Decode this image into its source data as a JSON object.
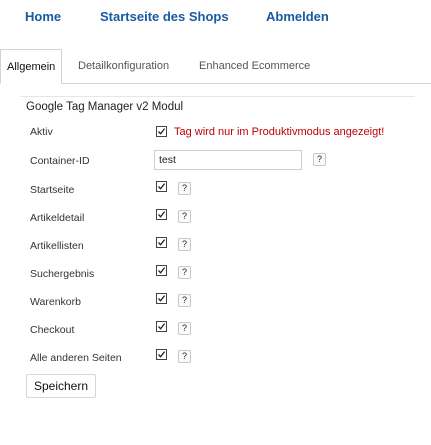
{
  "nav": {
    "home": "Home",
    "shop_home": "Startseite des Shops",
    "logout": "Abmelden"
  },
  "tabs": [
    {
      "label": "Allgemein",
      "active": true
    },
    {
      "label": "Detailkonfiguration",
      "active": false
    },
    {
      "label": "Enhanced Ecommerce",
      "active": false
    }
  ],
  "form": {
    "legend": "Google Tag Manager v2 Modul",
    "aktiv": {
      "label": "Aktiv",
      "checked": true,
      "hint": "Tag wird nur im Produktivmodus angezeigt!"
    },
    "container": {
      "label": "Container-ID",
      "value": "test"
    },
    "pages": [
      {
        "label": "Startseite",
        "checked": true
      },
      {
        "label": "Artikeldetail",
        "checked": true
      },
      {
        "label": "Artikellisten",
        "checked": true
      },
      {
        "label": "Suchergebnis",
        "checked": true
      },
      {
        "label": "Warenkorb",
        "checked": true
      },
      {
        "label": "Checkout",
        "checked": true
      },
      {
        "label": "Alle anderen Seiten",
        "checked": true
      }
    ],
    "help_label": "?",
    "save_label": "Speichern"
  },
  "colors": {
    "link": "#1a5aa0",
    "hint": "#c00000",
    "border": "#cfd3d6"
  }
}
